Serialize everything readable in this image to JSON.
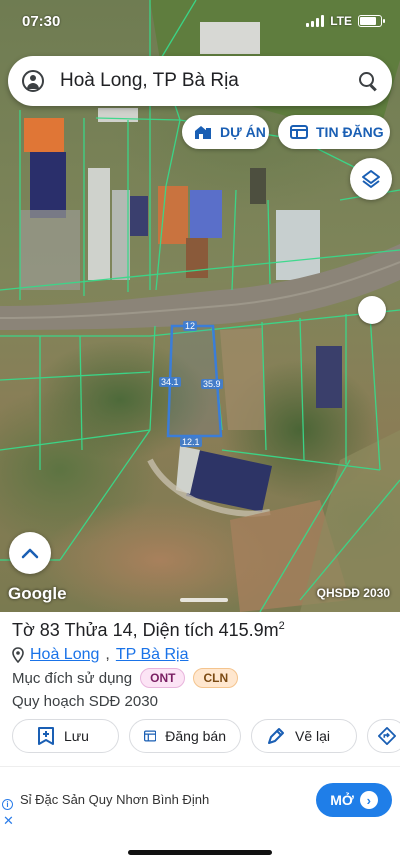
{
  "status": {
    "time": "07:30",
    "network": "LTE"
  },
  "search": {
    "query": "Hoà Long, TP Bà Rịa"
  },
  "chips": {
    "du_an": "DỰ ÁN",
    "tin_dang": "TIN ĐĂNG"
  },
  "map": {
    "labels": {
      "top": "12",
      "left": "34.1",
      "right": "35.9",
      "bottom": "12.1"
    },
    "attribution": "Google",
    "layer_label": "QHSDĐ 2030",
    "parcel_outline_color": "#39d98a",
    "selected_outline_color": "#3b7dd8"
  },
  "parcel": {
    "title_prefix": "Tờ 83 Thửa 14, Diện tích 415.9m",
    "title_sup": "2",
    "ward_link": "Hoà Long",
    "separator": ",",
    "city_link": "TP Bà Rịa",
    "purpose_label": "Mục đích sử dụng",
    "purpose_badges": [
      "ONT",
      "CLN"
    ],
    "plan_label": "Quy hoạch SDĐ 2030"
  },
  "actions": {
    "save": "Lưu",
    "post_sale": "Đăng bán",
    "redraw": "Vẽ lại"
  },
  "ad": {
    "text": "Sỉ Đặc Sản Quy Nhơn Bình Định",
    "cta": "MỞ"
  },
  "colors": {
    "accent": "#1a5fb4",
    "link": "#1a73e8",
    "cta": "#1f7ee8"
  }
}
